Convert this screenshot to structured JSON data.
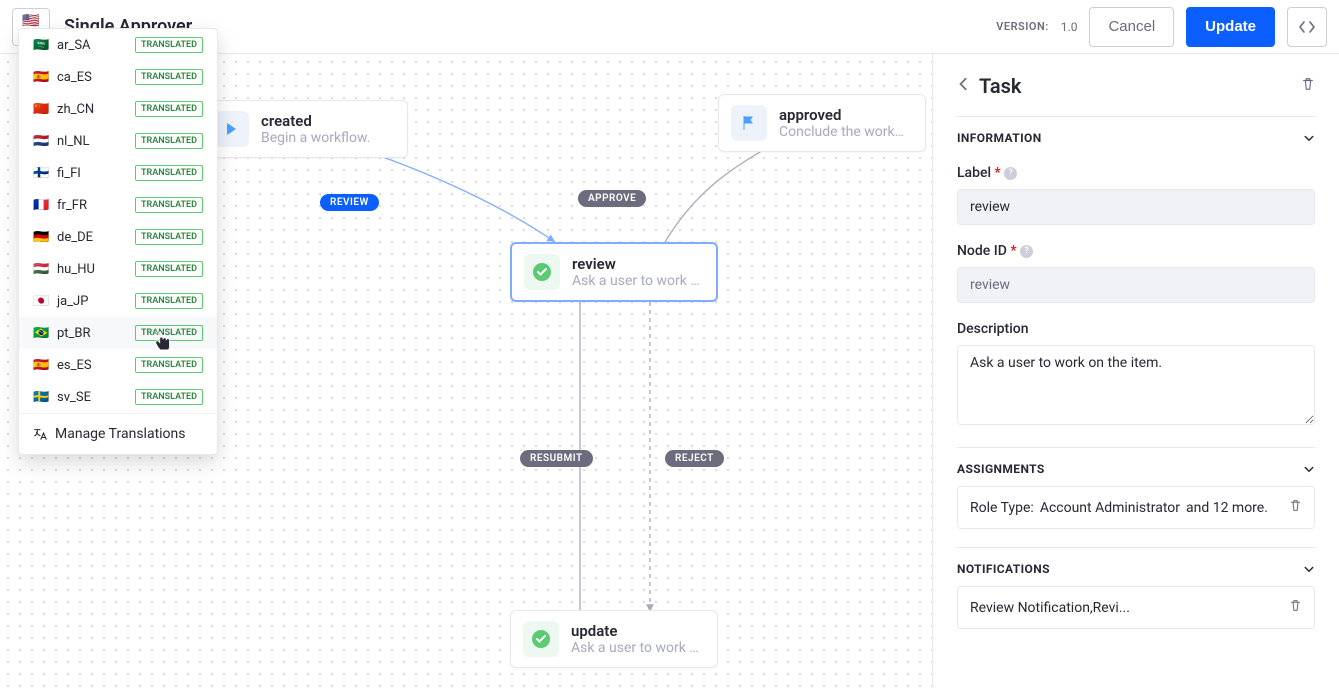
{
  "header": {
    "locale_selected": "en_US",
    "title": "Single Approver",
    "version_label": "VERSION:",
    "version_value": "1.0",
    "cancel": "Cancel",
    "update": "Update"
  },
  "locales": [
    {
      "code": "ar_SA",
      "flag": "🇸🇦",
      "status": "TRANSLATED"
    },
    {
      "code": "ca_ES",
      "flag": "🇪🇸",
      "status": "TRANSLATED"
    },
    {
      "code": "zh_CN",
      "flag": "🇨🇳",
      "status": "TRANSLATED"
    },
    {
      "code": "nl_NL",
      "flag": "🇳🇱",
      "status": "TRANSLATED"
    },
    {
      "code": "fi_FI",
      "flag": "🇫🇮",
      "status": "TRANSLATED"
    },
    {
      "code": "fr_FR",
      "flag": "🇫🇷",
      "status": "TRANSLATED"
    },
    {
      "code": "de_DE",
      "flag": "🇩🇪",
      "status": "TRANSLATED"
    },
    {
      "code": "hu_HU",
      "flag": "🇭🇺",
      "status": "TRANSLATED"
    },
    {
      "code": "ja_JP",
      "flag": "🇯🇵",
      "status": "TRANSLATED"
    },
    {
      "code": "pt_BR",
      "flag": "🇧🇷",
      "status": "TRANSLATED",
      "hovered": true
    },
    {
      "code": "es_ES",
      "flag": "🇪🇸",
      "status": "TRANSLATED"
    },
    {
      "code": "sv_SE",
      "flag": "🇸🇪",
      "status": "TRANSLATED"
    }
  ],
  "locale_manage": "Manage Translations",
  "nodes": {
    "created": {
      "title": "created",
      "desc": "Begin a workflow."
    },
    "approved": {
      "title": "approved",
      "desc": "Conclude the workfl..."
    },
    "review": {
      "title": "review",
      "desc": "Ask a user to work o..."
    },
    "update": {
      "title": "update",
      "desc": "Ask a user to work o..."
    }
  },
  "edges": {
    "review": "REVIEW",
    "approve": "APPROVE",
    "resubmit": "RESUBMIT",
    "reject": "REJECT"
  },
  "panel": {
    "title": "Task",
    "sections": {
      "information": "INFORMATION",
      "assignments": "ASSIGNMENTS",
      "notifications": "NOTIFICATIONS"
    },
    "fields": {
      "label_label": "Label",
      "label_value": "review",
      "nodeid_label": "Node ID",
      "nodeid_value": "review",
      "description_label": "Description",
      "description_value": "Ask a user to work on the item."
    },
    "assignments_row": {
      "prefix": "Role Type:",
      "value": "Account Administrator",
      "suffix": "and 12 more."
    },
    "notifications_row": "Review Notification,Revi..."
  }
}
